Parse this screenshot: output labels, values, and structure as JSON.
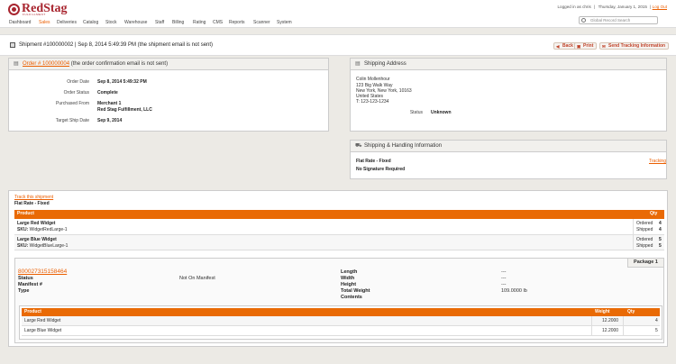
{
  "header": {
    "logo_text": "RedStag",
    "logo_sub": "FULFILLMENT",
    "logged_in": "Logged in as chris",
    "date": "Thursday, January 1, 2015",
    "logout": "Log Out",
    "search_placeholder": "Global Record Search"
  },
  "nav": {
    "items": [
      "Dashboard",
      "Sales",
      "Deliveries",
      "Catalog",
      "Stock",
      "Warehouse",
      "Staff",
      "Billing",
      "Rating",
      "CMS",
      "Reports",
      "Scanner",
      "System"
    ],
    "active": "Sales"
  },
  "titlebar": {
    "title": "Shipment #100000002 | Sep 8, 2014 5:49:39 PM (the shipment email is not sent)",
    "back": "Back",
    "print": "Print",
    "send_tracking": "Send Tracking Information"
  },
  "order": {
    "link": "Order # 100000004",
    "note": "(the order confirmation email is not sent)",
    "fields": [
      {
        "label": "Order Date",
        "value": "Sep 8, 2014 5:49:32 PM"
      },
      {
        "label": "Order Status",
        "value": "Complete"
      },
      {
        "label": "Purchased From",
        "value": "Merchant 1"
      },
      {
        "label": "",
        "value": "Red Stag Fulfillment, LLC"
      },
      {
        "label": "Target Ship Date",
        "value": "Sep 9, 2014"
      }
    ]
  },
  "shipping_address": {
    "title": "Shipping Address",
    "lines": [
      "Colin Mollenhour",
      "123 Big Walk Way",
      "New York, New York, 10163",
      "United States",
      "T: 123-123-1234"
    ],
    "status_label": "Status",
    "status_value": "Unknown"
  },
  "shipping_handling": {
    "title": "Shipping & Handling Information",
    "method": "Flat Rate - Fixed",
    "signature": "No Signature Required",
    "tracking": "Tracking"
  },
  "shipment": {
    "track_link": "Track this shipment",
    "method": "Flat Rate - Fixed",
    "headers": {
      "product": "Product",
      "qty": "Qty"
    },
    "items": [
      {
        "name": "Large Red Widget",
        "sku_label": "SKU:",
        "sku": "WidgetRedLarge-1",
        "ordered_label": "Ordered",
        "ordered": "4",
        "shipped_label": "Shipped",
        "shipped": "4"
      },
      {
        "name": "Large Blue Widget",
        "sku_label": "SKU:",
        "sku": "WidgetBlueLarge-1",
        "ordered_label": "Ordered",
        "ordered": "5",
        "shipped_label": "Shipped",
        "shipped": "5"
      }
    ]
  },
  "package": {
    "title": "Package 1",
    "tracking_number": "800027315158464",
    "left_labels": [
      "Status",
      "Manifest #",
      "Type"
    ],
    "status_value": "Not On Manifest",
    "right_labels": [
      "Length",
      "Width",
      "Height",
      "Total Weight",
      "Contents"
    ],
    "right_values": [
      "---",
      "---",
      "---",
      "109.0000 lb",
      ""
    ],
    "headers": {
      "product": "Product",
      "weight": "Weight",
      "qty": "Qty"
    },
    "items": [
      {
        "name": "Large Red Widget",
        "weight": "12.2000",
        "qty": "4"
      },
      {
        "name": "Large Blue Widget",
        "weight": "12.2000",
        "qty": "5"
      }
    ]
  },
  "colors": {
    "accent": "#e96a05",
    "brand": "#a8252f",
    "link": "#eb5e00"
  }
}
